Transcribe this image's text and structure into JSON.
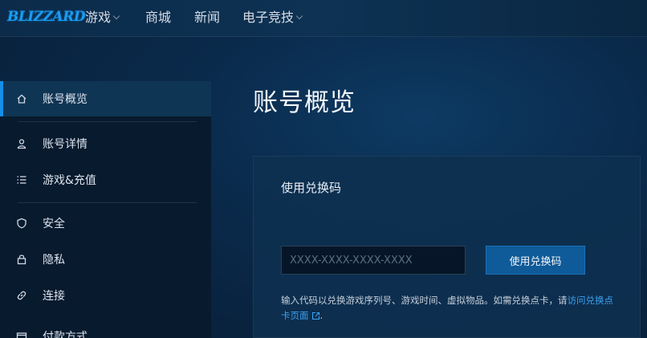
{
  "brand": {
    "logo_text": "BLIZZARD"
  },
  "nav": {
    "items": [
      {
        "label": "游戏",
        "has_dropdown": true
      },
      {
        "label": "商城",
        "has_dropdown": false
      },
      {
        "label": "新闻",
        "has_dropdown": false
      },
      {
        "label": "电子竞技",
        "has_dropdown": true
      }
    ]
  },
  "sidebar": {
    "items": [
      {
        "label": "账号概览",
        "icon": "home-icon",
        "active": true
      },
      {
        "label": "账号详情",
        "icon": "user-icon",
        "active": false
      },
      {
        "label": "游戏&充值",
        "icon": "list-icon",
        "active": false
      },
      {
        "label": "安全",
        "icon": "shield-icon",
        "active": false
      },
      {
        "label": "隐私",
        "icon": "lock-icon",
        "active": false
      },
      {
        "label": "连接",
        "icon": "link-icon",
        "active": false
      },
      {
        "label": "付款方式",
        "icon": "card-icon",
        "active": false
      }
    ]
  },
  "main": {
    "title": "账号概览",
    "redeem": {
      "title": "使用兑换码",
      "placeholder": "XXXX-XXXX-XXXX-XXXX",
      "button_label": "使用兑换码",
      "help_text": "输入代码以兑换游戏序列号、游戏时间、虚拟物品。如需兑换点卡，请",
      "help_link": "访问兑换点卡页面",
      "help_suffix": "."
    }
  },
  "colors": {
    "accent": "#148ee6",
    "link": "#3aa2f3",
    "button": "#0f5a98",
    "sidebar_bg": "#081a2e"
  }
}
